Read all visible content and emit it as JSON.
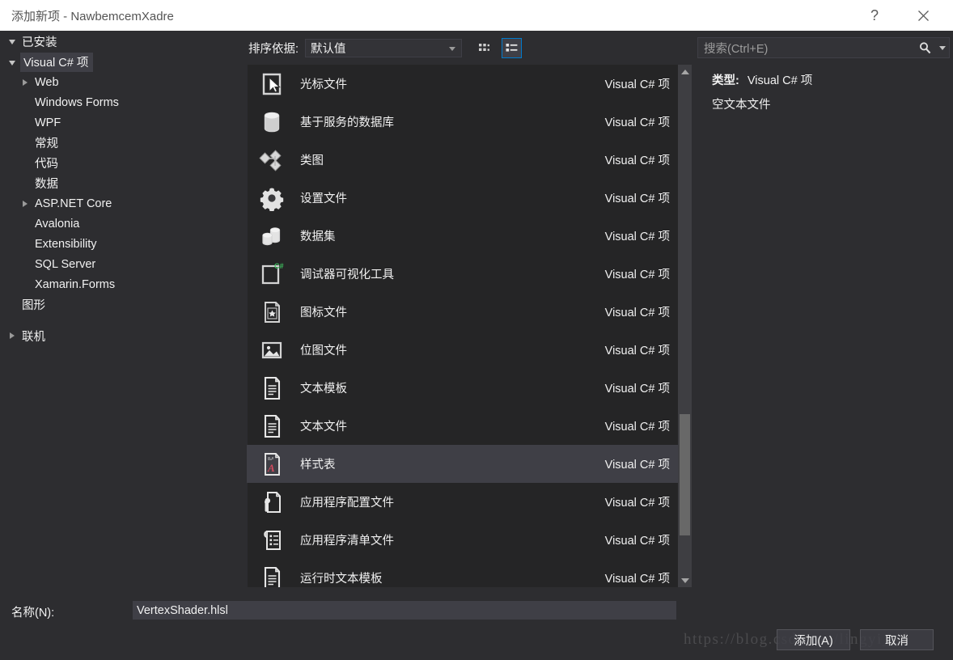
{
  "window": {
    "title": "添加新项 - NawbemcemXadre",
    "help_label": "?",
    "close_label": "✕"
  },
  "sidebar": {
    "installed_group": "已安装",
    "online_group": "联机",
    "items": [
      {
        "label": "Visual C# 项",
        "indent": 0,
        "arrow": "expanded",
        "selected": true
      },
      {
        "label": "Web",
        "indent": 1,
        "arrow": "collapsed",
        "selected": false
      },
      {
        "label": "Windows Forms",
        "indent": 1,
        "arrow": "none",
        "selected": false
      },
      {
        "label": "WPF",
        "indent": 1,
        "arrow": "none",
        "selected": false
      },
      {
        "label": "常规",
        "indent": 1,
        "arrow": "none",
        "selected": false
      },
      {
        "label": "代码",
        "indent": 1,
        "arrow": "none",
        "selected": false
      },
      {
        "label": "数据",
        "indent": 1,
        "arrow": "none",
        "selected": false
      },
      {
        "label": "ASP.NET Core",
        "indent": 1,
        "arrow": "collapsed",
        "selected": false
      },
      {
        "label": "Avalonia",
        "indent": 1,
        "arrow": "none",
        "selected": false
      },
      {
        "label": "Extensibility",
        "indent": 1,
        "arrow": "none",
        "selected": false
      },
      {
        "label": "SQL Server",
        "indent": 1,
        "arrow": "none",
        "selected": false
      },
      {
        "label": "Xamarin.Forms",
        "indent": 1,
        "arrow": "none",
        "selected": false
      },
      {
        "label": "图形",
        "indent": 0,
        "arrow": "none",
        "selected": false
      }
    ]
  },
  "toolbar": {
    "sort_label": "排序依据:",
    "sort_value": "默认值",
    "grid_view_icon": "grid-view-icon",
    "list_view_icon": "list-view-icon",
    "active_view": "list"
  },
  "templates": {
    "kind_label": "Visual C# 项",
    "selected_index": 10,
    "items": [
      {
        "name": "光标文件",
        "kind": "Visual C# 项",
        "icon": "cursor-file-icon"
      },
      {
        "name": "基于服务的数据库",
        "kind": "Visual C# 项",
        "icon": "database-icon"
      },
      {
        "name": "类图",
        "kind": "Visual C# 项",
        "icon": "class-diagram-icon"
      },
      {
        "name": "设置文件",
        "kind": "Visual C# 项",
        "icon": "gear-icon"
      },
      {
        "name": "数据集",
        "kind": "Visual C# 项",
        "icon": "dataset-icon"
      },
      {
        "name": "调试器可视化工具",
        "kind": "Visual C# 项",
        "icon": "debugger-visualizer-icon"
      },
      {
        "name": "图标文件",
        "kind": "Visual C# 项",
        "icon": "icon-file-icon"
      },
      {
        "name": "位图文件",
        "kind": "Visual C# 项",
        "icon": "bitmap-file-icon"
      },
      {
        "name": "文本模板",
        "kind": "Visual C# 项",
        "icon": "text-template-icon"
      },
      {
        "name": "文本文件",
        "kind": "Visual C# 项",
        "icon": "text-file-icon"
      },
      {
        "name": "样式表",
        "kind": "Visual C# 项",
        "icon": "stylesheet-icon"
      },
      {
        "name": "应用程序配置文件",
        "kind": "Visual C# 项",
        "icon": "app-config-icon"
      },
      {
        "name": "应用程序清单文件",
        "kind": "Visual C# 项",
        "icon": "app-manifest-icon"
      },
      {
        "name": "运行时文本模板",
        "kind": "Visual C# 项",
        "icon": "runtime-text-template-icon"
      }
    ]
  },
  "search": {
    "placeholder": "搜索(Ctrl+E)",
    "value": "",
    "icon": "search-icon"
  },
  "details": {
    "type_label": "类型:",
    "type_value": "Visual C# 项",
    "description": "空文本文件"
  },
  "footer": {
    "name_label": "名称(N):",
    "name_value": "VertexShader.hlsl",
    "add_button": "添加(A)",
    "cancel_button": "取消",
    "watermark": "https://blog.csdn.net/lingyi_gd"
  },
  "colors": {
    "window_bg": "#2d2d30",
    "list_bg": "#252526",
    "selection": "#3f3f46",
    "accent": "#007acc",
    "text": "#f1f1f1",
    "titlebar_bg": "#ffffff"
  }
}
